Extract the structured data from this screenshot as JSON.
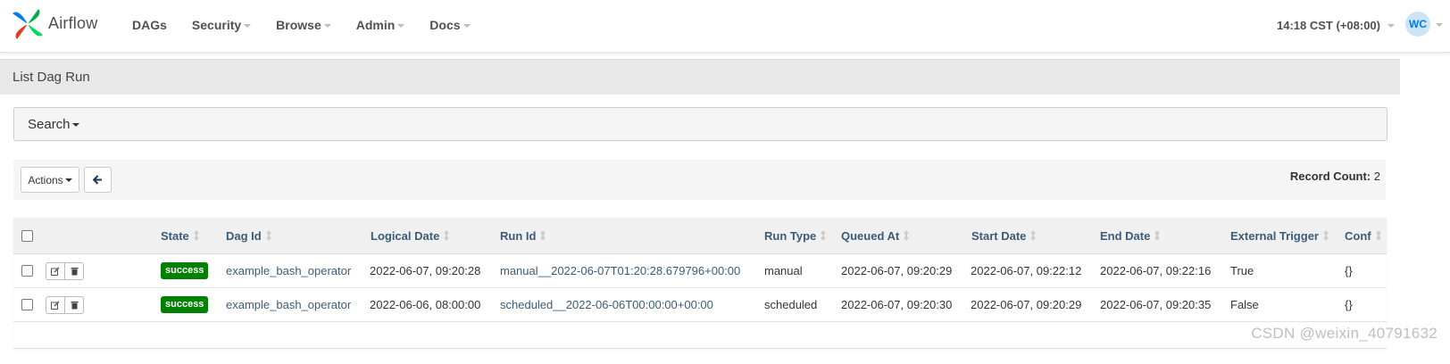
{
  "navbar": {
    "brand": "Airflow",
    "menu": [
      {
        "label": "DAGs",
        "has_caret": false
      },
      {
        "label": "Security",
        "has_caret": true
      },
      {
        "label": "Browse",
        "has_caret": true
      },
      {
        "label": "Admin",
        "has_caret": true
      },
      {
        "label": "Docs",
        "has_caret": true
      }
    ],
    "clock": "14:18 CST (+08:00)",
    "user_initials": "WC"
  },
  "page": {
    "title": "List Dag Run"
  },
  "search": {
    "label": "Search"
  },
  "actions": {
    "actions_label": "Actions",
    "back_icon": "arrow-left-icon",
    "record_count_label": "Record Count:",
    "record_count_value": "2"
  },
  "table": {
    "columns": [
      "State",
      "Dag Id",
      "Logical Date",
      "Run Id",
      "Run Type",
      "Queued At",
      "Start Date",
      "End Date",
      "External Trigger",
      "Conf"
    ],
    "rows": [
      {
        "state": "success",
        "dag_id": "example_bash_operator",
        "logical_date": "2022-06-07, 09:20:28",
        "run_id": "manual__2022-06-07T01:20:28.679796+00:00",
        "run_type": "manual",
        "queued_at": "2022-06-07, 09:20:29",
        "start_date": "2022-06-07, 09:22:12",
        "end_date": "2022-06-07, 09:22:16",
        "external_trigger": "True",
        "conf": "{}"
      },
      {
        "state": "success",
        "dag_id": "example_bash_operator",
        "logical_date": "2022-06-06, 08:00:00",
        "run_id": "scheduled__2022-06-06T00:00:00+00:00",
        "run_type": "scheduled",
        "queued_at": "2022-06-07, 09:20:30",
        "start_date": "2022-06-07, 09:20:29",
        "end_date": "2022-06-07, 09:20:35",
        "external_trigger": "False",
        "conf": "{}"
      }
    ]
  },
  "watermark": "CSDN @weixin_40791632",
  "colors": {
    "success": "#008000",
    "link": "#3c5b78",
    "header_bg": "#e8e8e8",
    "avatar_bg": "#cde3f8",
    "avatar_fg": "#017cee"
  }
}
